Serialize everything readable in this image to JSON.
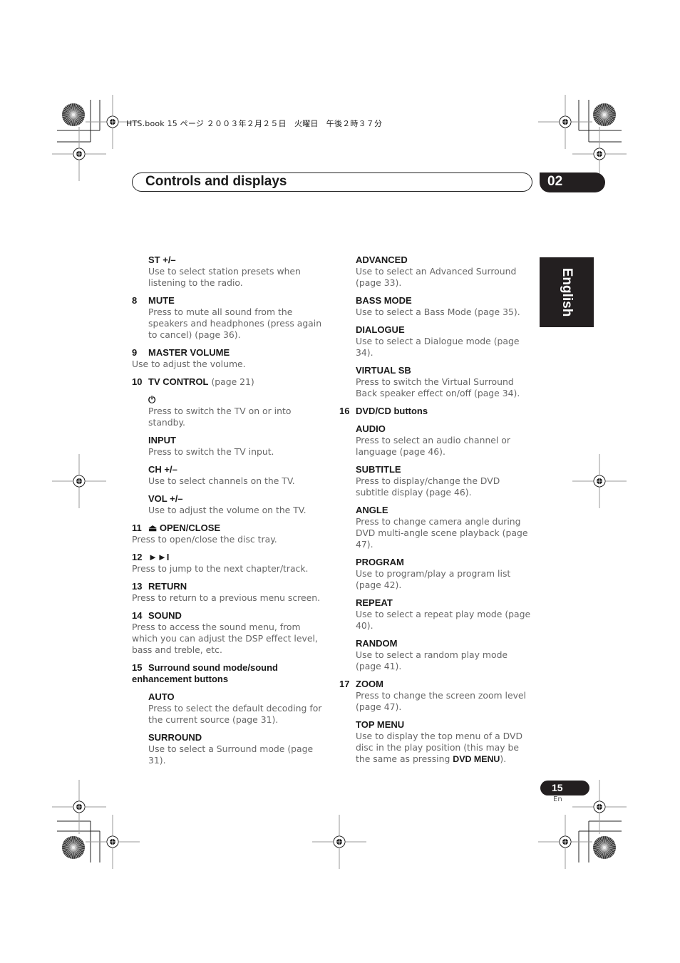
{
  "print_info": "HTS.book  15 ページ  ２００３年２月２５日　火曜日　午後２時３７分",
  "header": {
    "title": "Controls and displays",
    "chapter": "02"
  },
  "language_tab": "English",
  "left_column": [
    {
      "num": "",
      "title": "ST +/–",
      "indent": true,
      "desc": "Use to select station presets when listening to the radio."
    },
    {
      "num": "8",
      "title": "MUTE",
      "indent": true,
      "desc": "Press to mute all sound from the speakers and headphones (press again to cancel) (page 36)."
    },
    {
      "num": "9",
      "title": "MASTER VOLUME",
      "indent": false,
      "desc": "Use to adjust the volume."
    },
    {
      "num": "10",
      "title": "TV CONTROL",
      "ref": " (page 21)",
      "indent": false,
      "desc": ""
    },
    {
      "num": "",
      "title": "⏻",
      "icon": "power-icon",
      "indent": true,
      "desc": "Press to switch the TV on or into standby."
    },
    {
      "num": "",
      "title": "INPUT",
      "indent": true,
      "desc": "Press to switch the TV input."
    },
    {
      "num": "",
      "title": "CH +/–",
      "indent": true,
      "desc": "Use to select channels on the TV."
    },
    {
      "num": "",
      "title": "VOL +/–",
      "indent": true,
      "desc": "Use to adjust the volume on the TV."
    },
    {
      "num": "11",
      "title": "⏏ OPEN/CLOSE",
      "indent": false,
      "desc": "Press to open/close the disc tray."
    },
    {
      "num": "12",
      "title": "►►I",
      "icon": "next-track-icon",
      "indent": false,
      "desc": "Press to jump to the next chapter/track."
    },
    {
      "num": "13",
      "title": "RETURN",
      "indent": false,
      "desc": "Press to return to a previous menu screen."
    },
    {
      "num": "14",
      "title": "SOUND",
      "indent": false,
      "desc": "Press to access the sound menu, from which you can adjust the DSP effect level, bass and treble, etc."
    },
    {
      "num": "15",
      "title": "Surround sound mode/sound enhancement buttons",
      "indent": false,
      "desc": ""
    },
    {
      "num": "",
      "title": "AUTO",
      "indent": true,
      "desc": "Press to select the default decoding for the current source (page 31)."
    },
    {
      "num": "",
      "title": "SURROUND",
      "indent": true,
      "desc": "Use to select a Surround mode (page 31)."
    }
  ],
  "right_column": [
    {
      "num": "",
      "title": "ADVANCED",
      "indent": true,
      "desc": "Use to select an Advanced Surround (page 33)."
    },
    {
      "num": "",
      "title": "BASS MODE",
      "indent": true,
      "desc": "Use to select a Bass Mode (page 35)."
    },
    {
      "num": "",
      "title": "DIALOGUE",
      "indent": true,
      "desc": "Use to select a Dialogue mode (page 34)."
    },
    {
      "num": "",
      "title": "VIRTUAL SB",
      "indent": true,
      "desc": "Press to switch the Virtual Surround Back speaker effect on/off (page 34)."
    },
    {
      "num": "16",
      "title": "DVD/CD buttons",
      "indent": false,
      "desc": ""
    },
    {
      "num": "",
      "title": "AUDIO",
      "indent": true,
      "desc": "Press to select an audio channel or language (page 46)."
    },
    {
      "num": "",
      "title": "SUBTITLE",
      "indent": true,
      "desc": "Press to display/change the DVD subtitle display (page 46)."
    },
    {
      "num": "",
      "title": "ANGLE",
      "indent": true,
      "desc": "Press to change camera angle during DVD multi-angle scene playback (page 47)."
    },
    {
      "num": "",
      "title": "PROGRAM",
      "indent": true,
      "desc": "Use to program/play a program list (page 42)."
    },
    {
      "num": "",
      "title": "REPEAT",
      "indent": true,
      "desc": "Use to select a repeat play mode (page 40)."
    },
    {
      "num": "",
      "title": "RANDOM",
      "indent": true,
      "desc": "Use to select a random play mode (page 41)."
    },
    {
      "num": "17",
      "title": "ZOOM",
      "indent": true,
      "desc": "Press to change the screen zoom level (page 47)."
    },
    {
      "num": "",
      "title": "TOP MENU",
      "indent": true,
      "desc": "Use to display the top menu of a DVD disc in the play position (this may be the same as pressing ",
      "desc_bold": "DVD MENU",
      "desc_tail": ")."
    }
  ],
  "footer": {
    "page_number": "15",
    "page_lang": "En"
  }
}
